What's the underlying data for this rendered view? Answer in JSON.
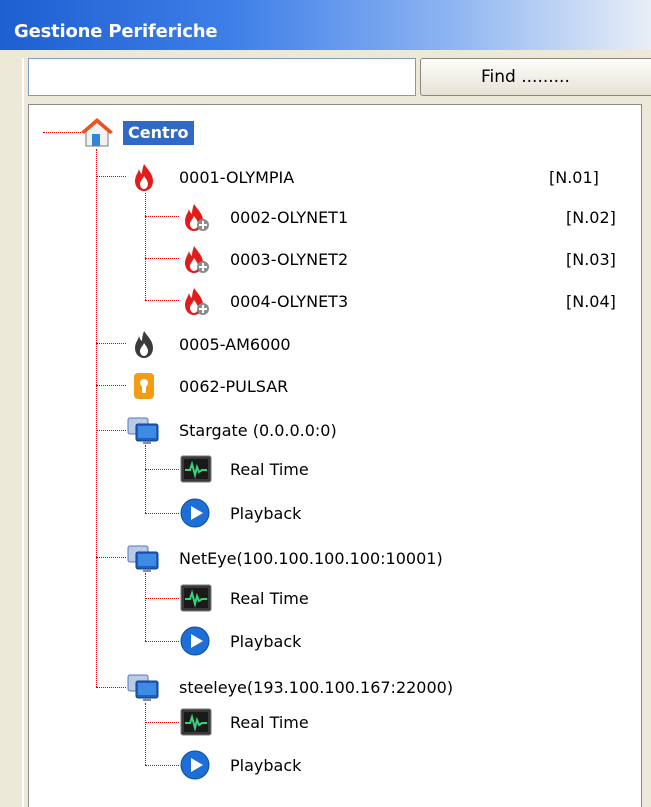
{
  "window": {
    "title": "Gestione Periferiche"
  },
  "search": {
    "value": "",
    "placeholder": "",
    "find_label": "Find ........."
  },
  "tree": {
    "root": {
      "label": "Centro",
      "icon": "home-icon"
    },
    "olympia": {
      "label": "0001-OLYMPIA",
      "code": "[N.01]",
      "icon": "fire-icon"
    },
    "olynet1": {
      "label": "0002-OLYNET1",
      "code": "[N.02]",
      "icon": "fire-add-icon"
    },
    "olynet2": {
      "label": "0003-OLYNET2",
      "code": "[N.03]",
      "icon": "fire-add-icon"
    },
    "olynet3": {
      "label": "0004-OLYNET3",
      "code": "[N.04]",
      "icon": "fire-add-icon"
    },
    "am6000": {
      "label": "0005-AM6000",
      "icon": "fire-gray-icon"
    },
    "pulsar": {
      "label": "0062-PULSAR",
      "icon": "keyhole-shield-icon"
    },
    "stargate": {
      "label": "Stargate (0.0.0.0:0)",
      "icon": "monitor-icon",
      "realtime": "Real Time",
      "playback": "Playback"
    },
    "neteye": {
      "label": "NetEye(100.100.100.100:10001)",
      "icon": "monitor-icon",
      "realtime": "Real Time",
      "playback": "Playback"
    },
    "steeleye": {
      "label": "steeleye(193.100.100.167:22000)",
      "icon": "monitor-icon",
      "realtime": "Real Time",
      "playback": "Playback"
    }
  },
  "colors": {
    "titlebar": "#1e5fd1",
    "selection": "#316ac5",
    "tree_lines": "#e00000",
    "fire": "#e02020"
  }
}
